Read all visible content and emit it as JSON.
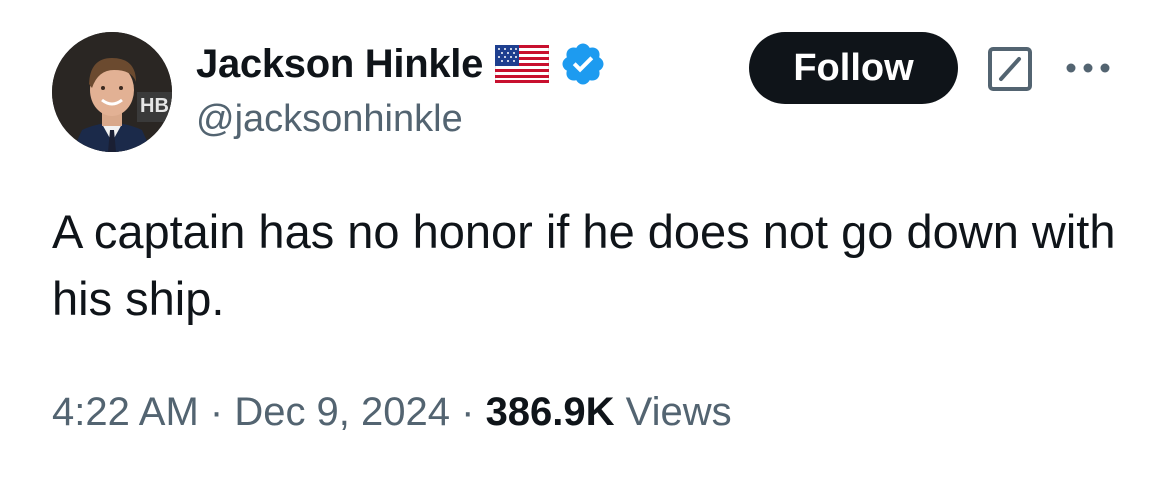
{
  "author": {
    "display_name": "Jackson Hinkle",
    "handle": "@jacksonhinkle",
    "flag_icon": "us-flag-icon",
    "verified_icon": "verified-badge-icon",
    "verified_color": "#1d9bf0"
  },
  "actions": {
    "follow_label": "Follow",
    "grok_icon": "grok-icon",
    "more_icon": "more-icon"
  },
  "tweet": {
    "text": "A captain has no honor if he does not go down with his ship."
  },
  "meta": {
    "time": "4:22 AM",
    "separator1": " · ",
    "date": "Dec 9, 2024",
    "separator2": " · ",
    "views_count": "386.9K",
    "views_label": " Views"
  },
  "colors": {
    "text_primary": "#0f1419",
    "text_secondary": "#536471",
    "button_bg": "#0f1419"
  }
}
